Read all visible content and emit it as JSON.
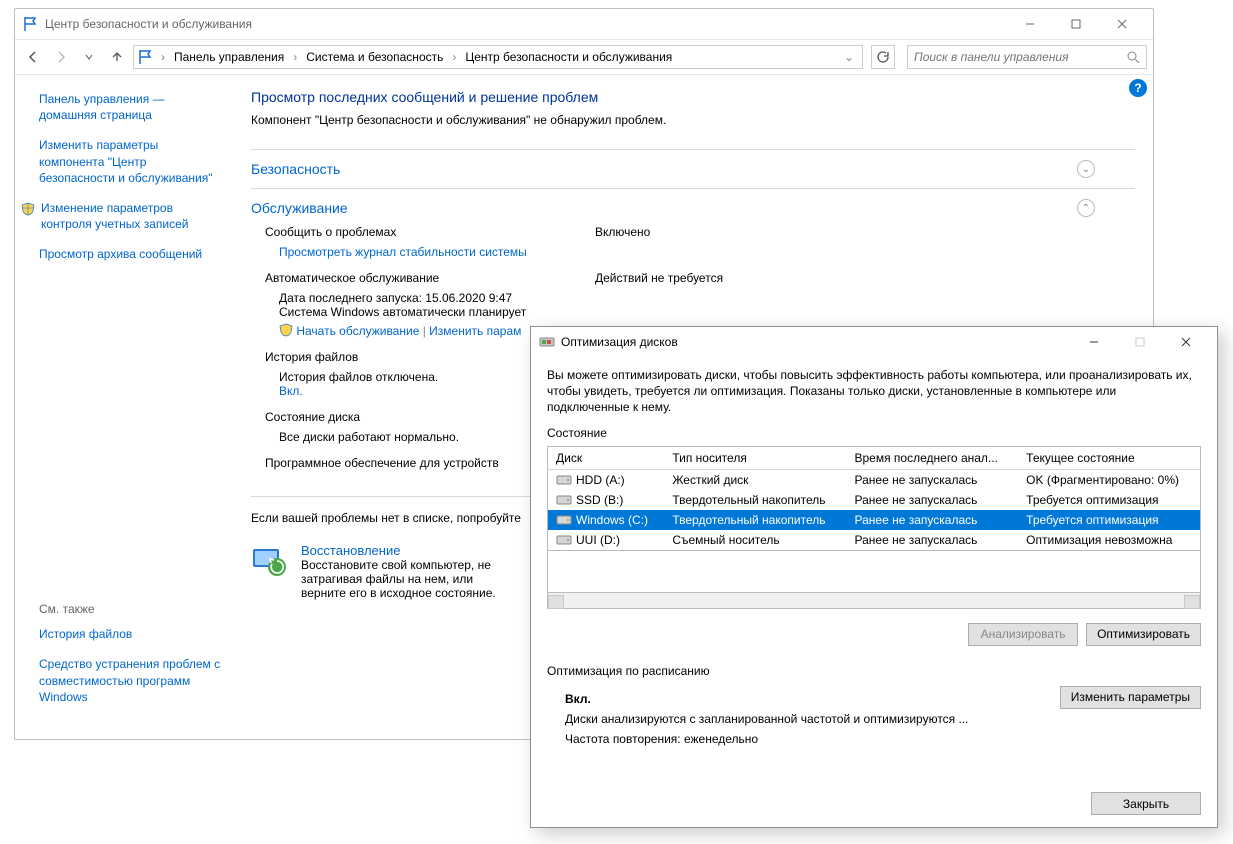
{
  "mainWindow": {
    "title": "Центр безопасности и обслуживания",
    "breadcrumbs": [
      "Панель управления",
      "Система и безопасность",
      "Центр безопасности и обслуживания"
    ],
    "searchPlaceholder": "Поиск в панели управления",
    "sidebar": {
      "links": [
        "Панель управления — домашняя страница",
        "Изменить параметры компонента \"Центр безопасности и обслуживания\"",
        "Изменение параметров контроля учетных записей",
        "Просмотр архива сообщений"
      ],
      "seeAlsoTitle": "См. также",
      "seeAlso": [
        "История файлов",
        "Средство устранения проблем с совместимостью программ Windows"
      ]
    },
    "heading": "Просмотр последних сообщений и решение проблем",
    "subheading": "Компонент \"Центр безопасности и обслуживания\" не обнаружил проблем.",
    "sections": {
      "security": {
        "title": "Безопасность"
      },
      "maintenance": {
        "title": "Обслуживание",
        "reportLabel": "Сообщить о проблемах",
        "reportValue": "Включено",
        "reliabilityLink": "Просмотреть журнал стабильности системы",
        "autoTitle": "Автоматическое обслуживание",
        "autoStatus": "Действий не требуется",
        "autoLast": "Дата последнего запуска: 15.06.2020 9:47",
        "autoLine2": "Система Windows автоматически планирует",
        "startMaint": "Начать обслуживание",
        "changeMaint": "Изменить парам",
        "fileHistTitle": "История файлов",
        "fileHistStatus": "История файлов отключена.",
        "fileHistOn": "Вкл.",
        "diskTitle": "Состояние диска",
        "diskStatus": "Все диски работают нормально.",
        "devSoftware": "Программное обеспечение для устройств"
      }
    },
    "troubleshoot": "Если вашей проблемы нет в списке, попробуйте",
    "recovery": {
      "title": "Восстановление",
      "desc": "Восстановите свой компьютер, не затрагивая файлы на нем, или верните его в исходное состояние."
    }
  },
  "optWindow": {
    "title": "Оптимизация дисков",
    "desc": "Вы можете оптимизировать диски, чтобы повысить эффективность работы  компьютера, или проанализировать их, чтобы увидеть, требуется ли оптимизация. Показаны только диски, установленные в компьютере или подключенные к нему.",
    "stateLabel": "Состояние",
    "columns": [
      "Диск",
      "Тип носителя",
      "Время последнего анал...",
      "Текущее состояние"
    ],
    "rows": [
      {
        "name": "HDD (A:)",
        "type": "Жесткий диск",
        "last": "Ранее не запускалась",
        "state": "OK (Фрагментировано: 0%)",
        "sel": false
      },
      {
        "name": "SSD (B:)",
        "type": "Твердотельный накопитель",
        "last": "Ранее не запускалась",
        "state": "Требуется оптимизация",
        "sel": false
      },
      {
        "name": "Windows (C:)",
        "type": "Твердотельный накопитель",
        "last": "Ранее не запускалась",
        "state": "Требуется оптимизация",
        "sel": true
      },
      {
        "name": "UUI (D:)",
        "type": "Съемный носитель",
        "last": "Ранее не запускалась",
        "state": "Оптимизация невозможна",
        "sel": false
      }
    ],
    "analyzeBtn": "Анализировать",
    "optimizeBtn": "Оптимизировать",
    "schedTitle": "Оптимизация по расписанию",
    "schedOn": "Вкл.",
    "schedLine1": "Диски анализируются с запланированной частотой и оптимизируются ...",
    "schedLine2": "Частота повторения: еженедельно",
    "changeBtn": "Изменить параметры",
    "closeBtn": "Закрыть"
  }
}
